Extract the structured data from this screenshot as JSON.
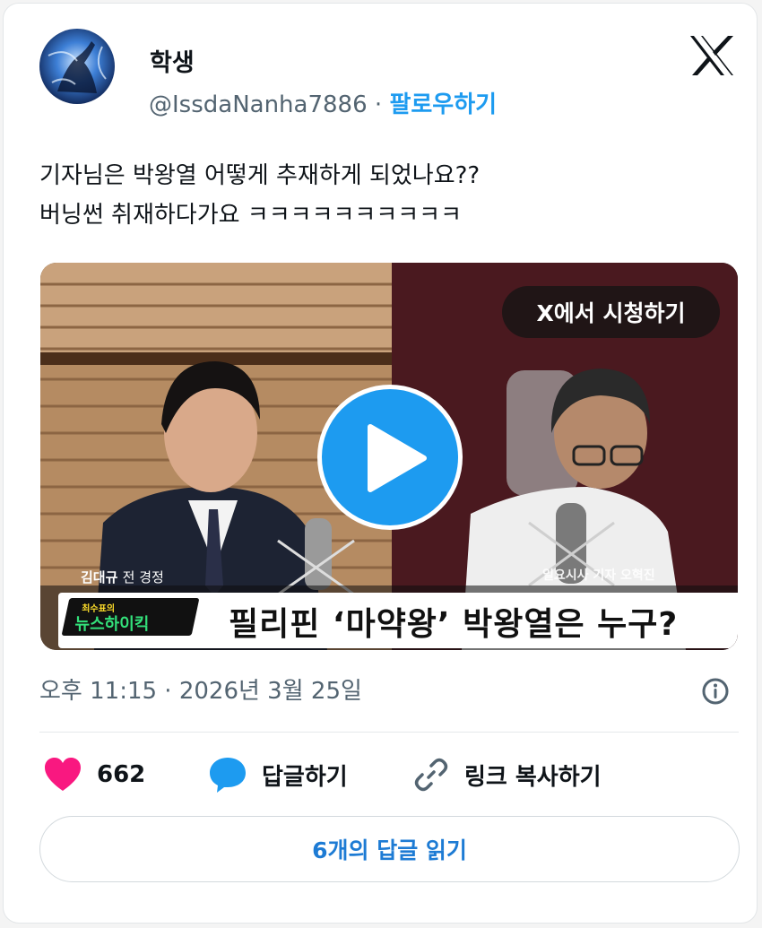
{
  "author": {
    "display_name": "학생",
    "handle": "@IssdaNanha7886",
    "separator": "·",
    "follow_label": "팔로우하기"
  },
  "tweet": {
    "lines": [
      "기자님은 박왕열 어떻게 추재하게 되었나요??",
      "버닝썬 취재하다가요 ㅋㅋㅋㅋㅋㅋㅋㅋㅋㅋ"
    ]
  },
  "video": {
    "watch_label": "X에서 시청하기",
    "caption_left_name": "김대규",
    "caption_left_role": "전 경정",
    "caption_right": "일요시사 기자 오혁진",
    "show_logo_small": "최수표의",
    "show_logo_big": "뉴스하이킥",
    "headline": "필리핀 ‘마약왕’ 박왕열은 누구?"
  },
  "meta": {
    "timestamp": "오후 11:15 · 2026년 3월 25일"
  },
  "actions": {
    "like_count": "662",
    "reply_label": "답글하기",
    "copy_label": "링크 복사하기"
  },
  "read_replies_label": "6개의 답글 읽기",
  "colors": {
    "accent": "#1d9bf0",
    "like": "#f91880",
    "text_secondary": "#536471"
  },
  "icons": [
    "x-logo-icon",
    "play-icon",
    "info-icon",
    "heart-icon",
    "reply-bubble-icon",
    "link-icon"
  ]
}
